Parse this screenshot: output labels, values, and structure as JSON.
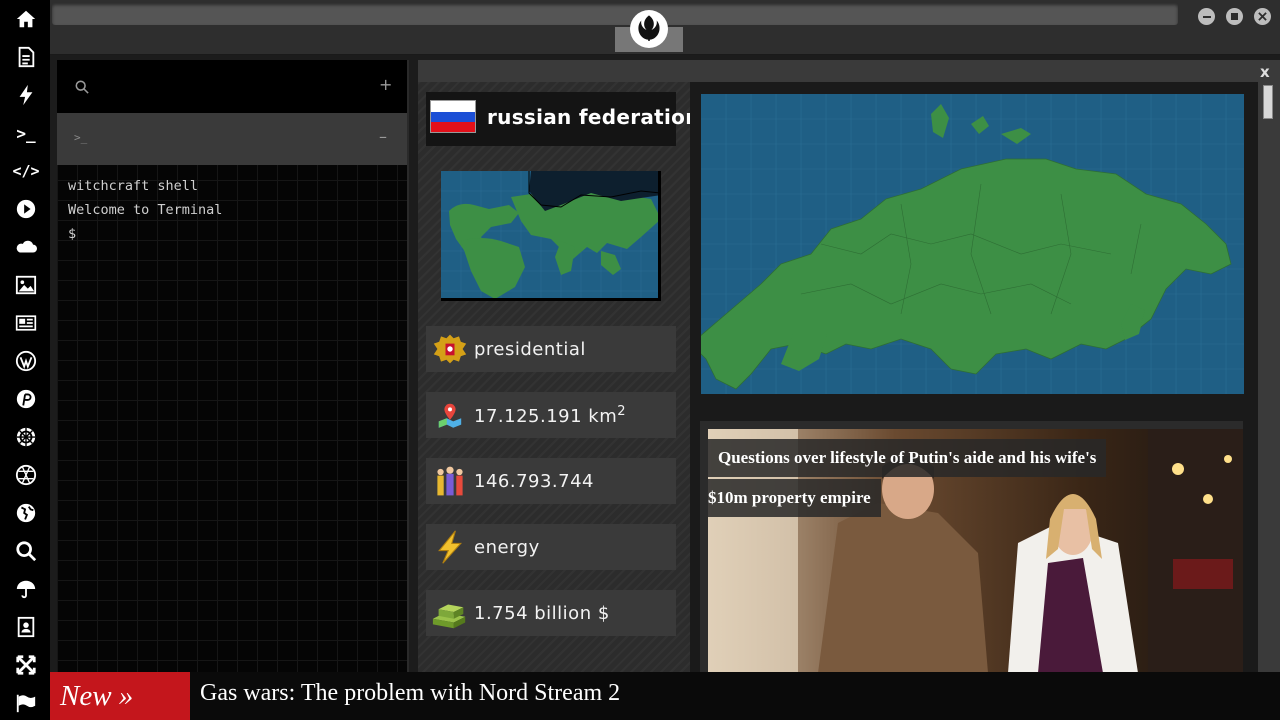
{
  "sidebar": {
    "icons": [
      "home-icon",
      "document-icon",
      "bolt-icon",
      "terminal-icon",
      "code-icon",
      "play-icon",
      "cloud-icon",
      "image-icon",
      "newspaper-icon",
      "wordpress-icon",
      "pinterest-icon",
      "settings-wheel-icon",
      "globe-mesh-icon",
      "earth-icon",
      "search-icon",
      "umbrella-icon",
      "contacts-icon",
      "expand-icon",
      "flag-icon"
    ],
    "terminal_glyph": ">_",
    "code_glyph": "</>"
  },
  "window": {
    "minimize": "–",
    "maximize": "■",
    "close": "×"
  },
  "terminal": {
    "add_label": "+",
    "tab_prompt": ">_",
    "tab_collapse": "–",
    "lines": [
      "witchcraft shell",
      "Welcome to Terminal",
      "$"
    ]
  },
  "country": {
    "name": "russian federation",
    "government": "presidential",
    "area_value": "17.125.191 km",
    "area_unit_sup": "2",
    "population": "146.793.744",
    "sector": "energy",
    "gdp": "1.754 billion $"
  },
  "news": {
    "headline_line1": "Questions over lifestyle of Putin's aide and his wife's",
    "headline_line2": "$10m property empire"
  },
  "ticker": {
    "label": "New »",
    "text": "Gas wars: The problem with Nord Stream 2"
  },
  "colors": {
    "accent": "#c4161c",
    "map_sea": "#1f5f85",
    "map_land": "#3d8f45"
  },
  "close_label": "x"
}
